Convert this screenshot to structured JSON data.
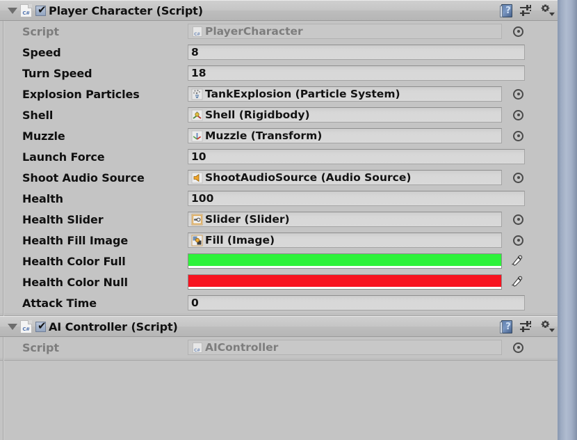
{
  "app": {
    "panel": "unity-inspector"
  },
  "colors": {
    "panel_bg": "#c4c4c4",
    "field_bg": "#d6d6d6",
    "scrollbar": "#9dabc2",
    "health_color_full": "#2df23a",
    "health_color_null": "#f7121f"
  },
  "components": [
    {
      "title": "Player Character (Script)",
      "enabled": true,
      "expanded": true,
      "script_icon": "csharp-script-icon",
      "header_buttons": [
        {
          "name": "help-icon",
          "label": "?"
        },
        {
          "name": "preset-icon",
          "label": ""
        },
        {
          "name": "gear-icon",
          "label": ""
        }
      ],
      "rows": [
        {
          "label": "Script",
          "type": "script",
          "value": "PlayerCharacter",
          "icon": "csharp-script-icon",
          "picker": true
        },
        {
          "label": "Speed",
          "type": "number",
          "value": "8"
        },
        {
          "label": "Turn Speed",
          "type": "number",
          "value": "18"
        },
        {
          "label": "Explosion Particles",
          "type": "object",
          "value": "TankExplosion (Particle System)",
          "icon": "particle-system-icon",
          "picker": true
        },
        {
          "label": "Shell",
          "type": "object",
          "value": "Shell (Rigidbody)",
          "icon": "rigidbody-icon",
          "picker": true
        },
        {
          "label": "Muzzle",
          "type": "object",
          "value": "Muzzle (Transform)",
          "icon": "transform-icon",
          "picker": true
        },
        {
          "label": "Launch Force",
          "type": "number",
          "value": "10"
        },
        {
          "label": "Shoot Audio Source",
          "type": "object",
          "value": "ShootAudioSource (Audio Source)",
          "icon": "audio-source-icon",
          "picker": true
        },
        {
          "label": "Health",
          "type": "number",
          "value": "100"
        },
        {
          "label": "Health Slider",
          "type": "object",
          "value": "Slider (Slider)",
          "icon": "slider-icon",
          "picker": true
        },
        {
          "label": "Health Fill Image",
          "type": "object",
          "value": "Fill (Image)",
          "icon": "image-icon",
          "picker": true
        },
        {
          "label": "Health Color Full",
          "type": "color",
          "value": "#2df23a"
        },
        {
          "label": "Health Color Null",
          "type": "color",
          "value": "#f7121f"
        },
        {
          "label": "Attack Time",
          "type": "number",
          "value": "0"
        }
      ]
    },
    {
      "title": "AI Controller (Script)",
      "enabled": true,
      "expanded": true,
      "script_icon": "csharp-script-icon",
      "header_buttons": [
        {
          "name": "help-icon",
          "label": "?"
        },
        {
          "name": "preset-icon",
          "label": ""
        },
        {
          "name": "gear-icon",
          "label": ""
        }
      ],
      "rows": [
        {
          "label": "Script",
          "type": "script",
          "value": "AIController",
          "icon": "csharp-script-icon",
          "picker": true
        }
      ]
    }
  ]
}
